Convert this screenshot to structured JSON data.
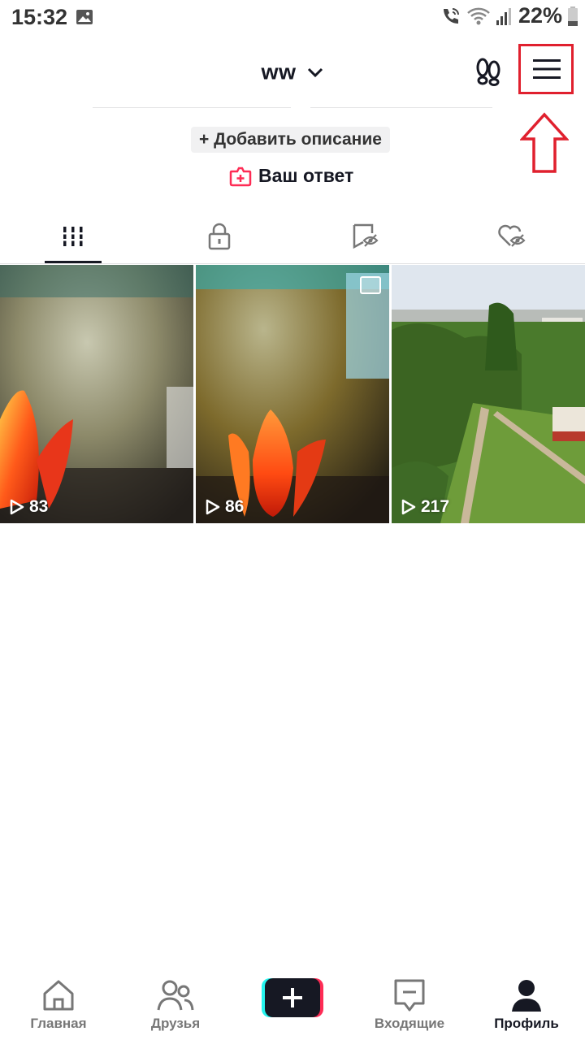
{
  "status": {
    "time": "15:32",
    "battery": "22%"
  },
  "profile": {
    "username": "ww",
    "add_description": "+ Добавить описание",
    "your_answer": "Ваш ответ"
  },
  "videos": [
    {
      "views": "83"
    },
    {
      "views": "86"
    },
    {
      "views": "217"
    }
  ],
  "nav": [
    {
      "label": "Главная",
      "icon": "home-icon"
    },
    {
      "label": "Друзья",
      "icon": "friends-icon"
    },
    {
      "label": "",
      "icon": "plus-icon"
    },
    {
      "label": "Входящие",
      "icon": "inbox-icon"
    },
    {
      "label": "Профиль",
      "icon": "profile-icon"
    }
  ],
  "colors": {
    "highlight": "#e0202e",
    "accent_pink": "#fe2c55",
    "accent_cyan": "#25f4ee"
  }
}
